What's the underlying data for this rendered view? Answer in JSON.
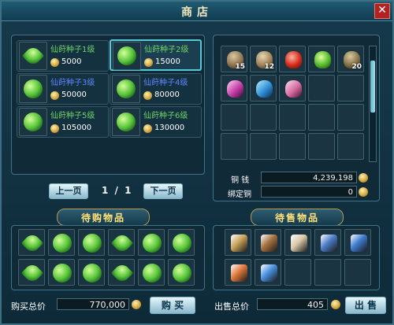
{
  "title": "商店",
  "close_label": "✕",
  "shop_items": [
    {
      "name": "仙莳种子1级",
      "price": "5000",
      "color": "green"
    },
    {
      "name": "仙莳种子2级",
      "price": "15000",
      "color": "green"
    },
    {
      "name": "仙莳种子3级",
      "price": "50000",
      "color": "blue"
    },
    {
      "name": "仙莳种子4级",
      "price": "80000",
      "color": "blue"
    },
    {
      "name": "仙莳种子5级",
      "price": "105000",
      "color": "green"
    },
    {
      "name": "仙莳种子6级",
      "price": "130000",
      "color": "green"
    }
  ],
  "pagination": {
    "prev_label": "上一页",
    "next_label": "下一页",
    "indicator": "1 / 1"
  },
  "bag": {
    "counts": [
      "15",
      "12",
      "",
      "",
      "20"
    ],
    "copper_label": "铜   钱",
    "copper_value": "4,239,198",
    "bound_label": "绑定铜",
    "bound_value": "0"
  },
  "to_buy": {
    "header": "待购物品",
    "total_label": "购买总价",
    "total_value": "770,000",
    "buy_label": "购 买"
  },
  "to_sell": {
    "header": "待售物品",
    "total_label": "出售总价",
    "total_value": "405",
    "sell_label": "出 售"
  }
}
